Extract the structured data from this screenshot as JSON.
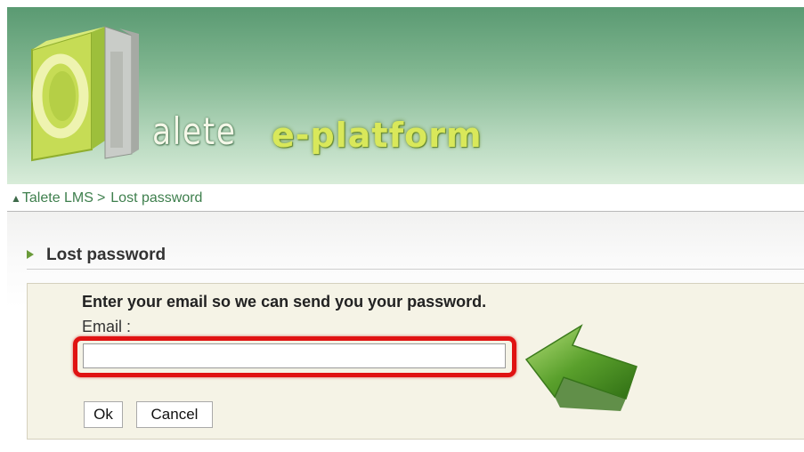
{
  "header": {
    "wordmark": "alete",
    "product": "e-platform"
  },
  "breadcrumb": {
    "home": "Talete LMS",
    "separator": ">",
    "current": "Lost password"
  },
  "section": {
    "title": "Lost password"
  },
  "form": {
    "instruction": "Enter your email so we can send you your password.",
    "email_label": "Email :",
    "email_value": "",
    "ok_label": "Ok",
    "cancel_label": "Cancel"
  },
  "colors": {
    "highlight": "#e01212",
    "arrow": "#5aa02c",
    "link": "#3e7f4d"
  }
}
